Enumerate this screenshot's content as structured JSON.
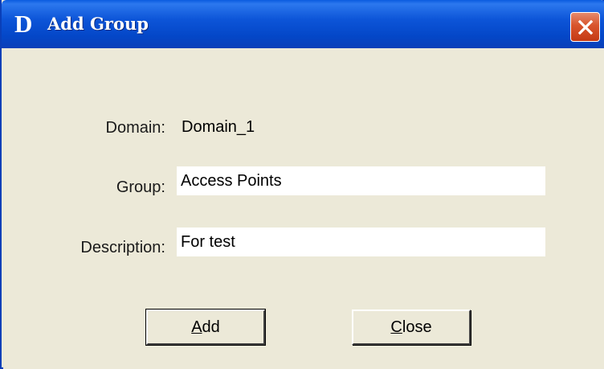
{
  "window": {
    "logo": "D",
    "title": "Add Group",
    "close_icon": "close-x-icon"
  },
  "form": {
    "domain_label": "Domain:",
    "domain_value": "Domain_1",
    "group_label": "Group:",
    "group_value": "Access Points",
    "description_label": "Description:",
    "description_value": "For test"
  },
  "buttons": {
    "add_mnemonic": "A",
    "add_rest": "dd",
    "close_mnemonic": "C",
    "close_rest": "lose"
  },
  "colors": {
    "titlebar": "#0a50d0",
    "close_button": "#d8542c",
    "dialog_bg": "#ece9d8"
  }
}
